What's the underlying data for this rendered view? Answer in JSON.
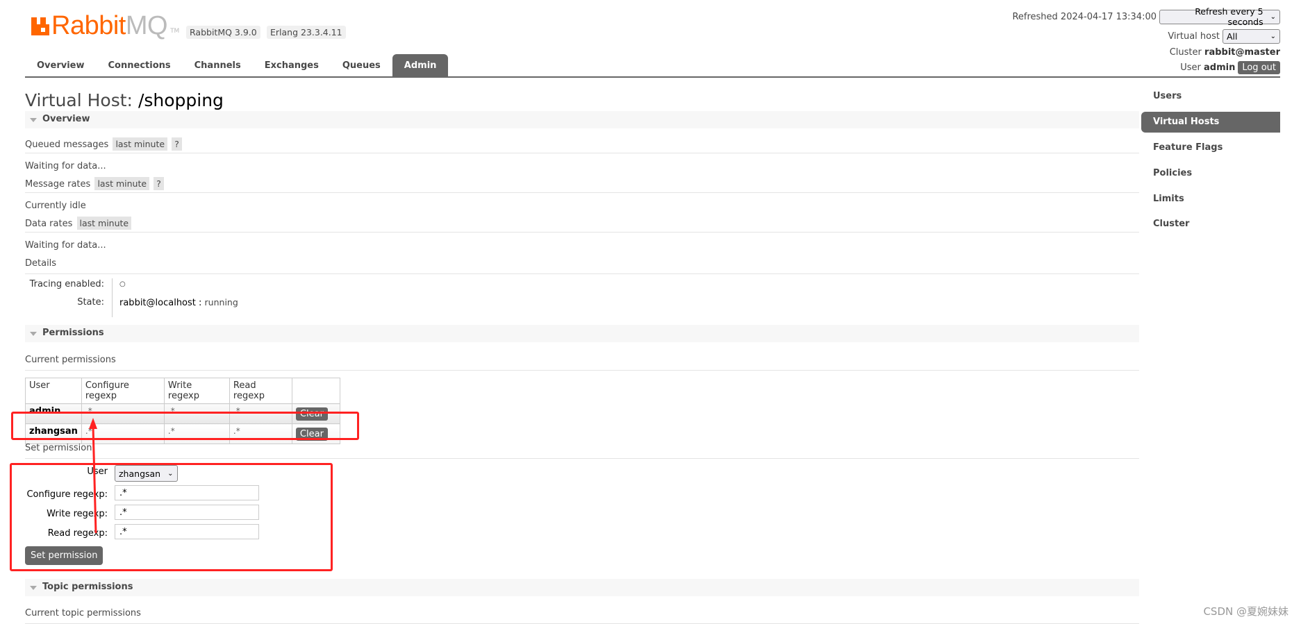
{
  "header": {
    "logo": {
      "brand_primary": "Rabbit",
      "brand_secondary": "MQ",
      "trademark": "TM"
    },
    "version_badges": [
      "RabbitMQ 3.9.0",
      "Erlang 23.3.4.11"
    ],
    "refreshed_label": "Refreshed 2024-04-17 13:34:00",
    "refresh_select": "Refresh every 5 seconds",
    "virtual_host_label": "Virtual host",
    "virtual_host_select": "All",
    "cluster_label": "Cluster",
    "cluster_value": "rabbit@master",
    "user_label": "User",
    "user_value": "admin",
    "logout_label": "Log out"
  },
  "nav": {
    "tabs": [
      "Overview",
      "Connections",
      "Channels",
      "Exchanges",
      "Queues",
      "Admin"
    ],
    "active": "Admin"
  },
  "page": {
    "title_prefix": "Virtual Host:",
    "title_vhost": "/shopping"
  },
  "overview": {
    "section_label": "Overview",
    "queued_messages": {
      "label": "Queued messages",
      "range": "last minute",
      "help": "?",
      "status": "Waiting for data..."
    },
    "message_rates": {
      "label": "Message rates",
      "range": "last minute",
      "help": "?",
      "status": "Currently idle"
    },
    "data_rates": {
      "label": "Data rates",
      "range": "last minute",
      "status": "Waiting for data..."
    },
    "details": {
      "label": "Details",
      "tracing_label": "Tracing enabled:",
      "tracing_value": "○",
      "state_label": "State:",
      "state_node": "rabbit@localhost :",
      "state_value": "running"
    }
  },
  "permissions": {
    "section_label": "Permissions",
    "current_label": "Current permissions",
    "columns": [
      "User",
      "Configure regexp",
      "Write regexp",
      "Read regexp",
      ""
    ],
    "rows": [
      {
        "user": "admin",
        "configure": ".*",
        "write": ".*",
        "read": ".*",
        "action": "Clear"
      },
      {
        "user": "zhangsan",
        "configure": ".*",
        "write": ".*",
        "read": ".*",
        "action": "Clear"
      }
    ],
    "set_label": "Set permission",
    "form": {
      "user_label": "User",
      "user_value": "zhangsan",
      "configure_label": "Configure regexp:",
      "configure_value": ".*",
      "write_label": "Write regexp:",
      "write_value": ".*",
      "read_label": "Read regexp:",
      "read_value": ".*",
      "submit_label": "Set permission"
    }
  },
  "topic_permissions": {
    "section_label": "Topic permissions",
    "current_label": "Current topic permissions"
  },
  "sidebar": {
    "items": [
      "Users",
      "Virtual Hosts",
      "Feature Flags",
      "Policies",
      "Limits",
      "Cluster"
    ],
    "active": "Virtual Hosts"
  },
  "annotation_color": "#ff2222",
  "watermark": "CSDN @夏婉妹妹"
}
